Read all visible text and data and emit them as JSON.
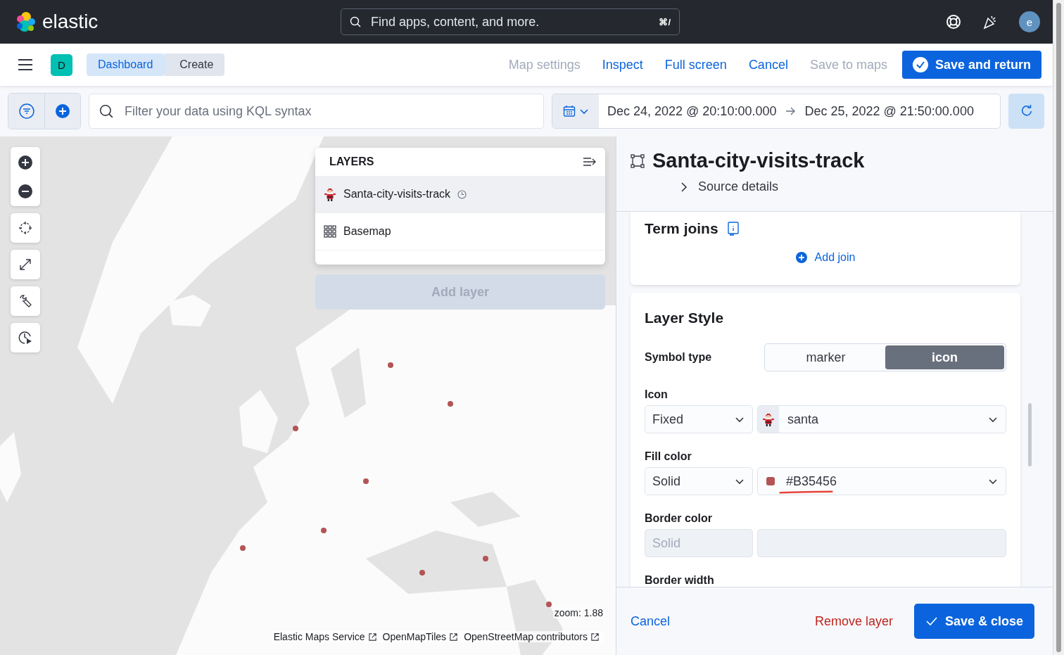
{
  "header": {
    "logo": "elastic",
    "search": {
      "placeholder": "Find apps, content, and more.",
      "shortcut": "⌘/"
    },
    "avatar": "e"
  },
  "nav": {
    "space": "D",
    "breadcrumbs": [
      {
        "label": "Dashboard",
        "selected": false
      },
      {
        "label": "Create",
        "selected": true
      }
    ],
    "actions": [
      {
        "label": "Map settings",
        "disabled": true
      },
      {
        "label": "Inspect",
        "disabled": false
      },
      {
        "label": "Full screen",
        "disabled": false
      },
      {
        "label": "Cancel",
        "disabled": false
      },
      {
        "label": "Save to maps",
        "disabled": true
      }
    ],
    "primary": "Save and return"
  },
  "query": {
    "placeholder": "Filter your data using KQL syntax",
    "start": "Dec 24, 2022 @ 20:10:00.000",
    "end": "Dec 25, 2022 @ 21:50:00.000"
  },
  "map": {
    "layers_title": "LAYERS",
    "layers": [
      {
        "name": "Santa-city-visits-track",
        "kind": "santa",
        "time_aware": true,
        "selected": true
      },
      {
        "name": "Basemap",
        "kind": "grid",
        "time_aware": false,
        "selected": false
      }
    ],
    "add_layer": {
      "label": "Add layer",
      "disabled": true
    },
    "zoom": "zoom: 1.88",
    "attribution": [
      "Elastic Maps Service",
      "OpenMapTiles",
      "OpenStreetMap contributors"
    ]
  },
  "panel": {
    "title": "Santa-city-visits-track",
    "source_details": {
      "label": "Source details",
      "expanded": false
    },
    "term_joins": {
      "title": "Term joins",
      "add": "Add join"
    },
    "layer_style": {
      "title": "Layer Style",
      "symbol_type": {
        "label": "Symbol type",
        "options": [
          {
            "label": "marker",
            "selected": false
          },
          {
            "label": "icon",
            "selected": true
          }
        ]
      },
      "fields": [
        {
          "label": "Icon",
          "mode": {
            "value": "Fixed",
            "disabled": false
          },
          "value": {
            "kind": "icon",
            "text": "santa",
            "disabled": false
          }
        },
        {
          "label": "Fill color",
          "mode": {
            "value": "Solid",
            "disabled": false
          },
          "value": {
            "kind": "color",
            "text": "#B35456",
            "color": "#b35456",
            "disabled": false,
            "underlined": true
          }
        },
        {
          "label": "Border color",
          "mode": {
            "value": "Solid",
            "disabled": true
          },
          "value": {
            "kind": "empty",
            "disabled": true
          }
        }
      ],
      "next_label": "Border width"
    },
    "footer": {
      "cancel": "Cancel",
      "remove": "Remove layer",
      "save": "Save & close"
    }
  }
}
